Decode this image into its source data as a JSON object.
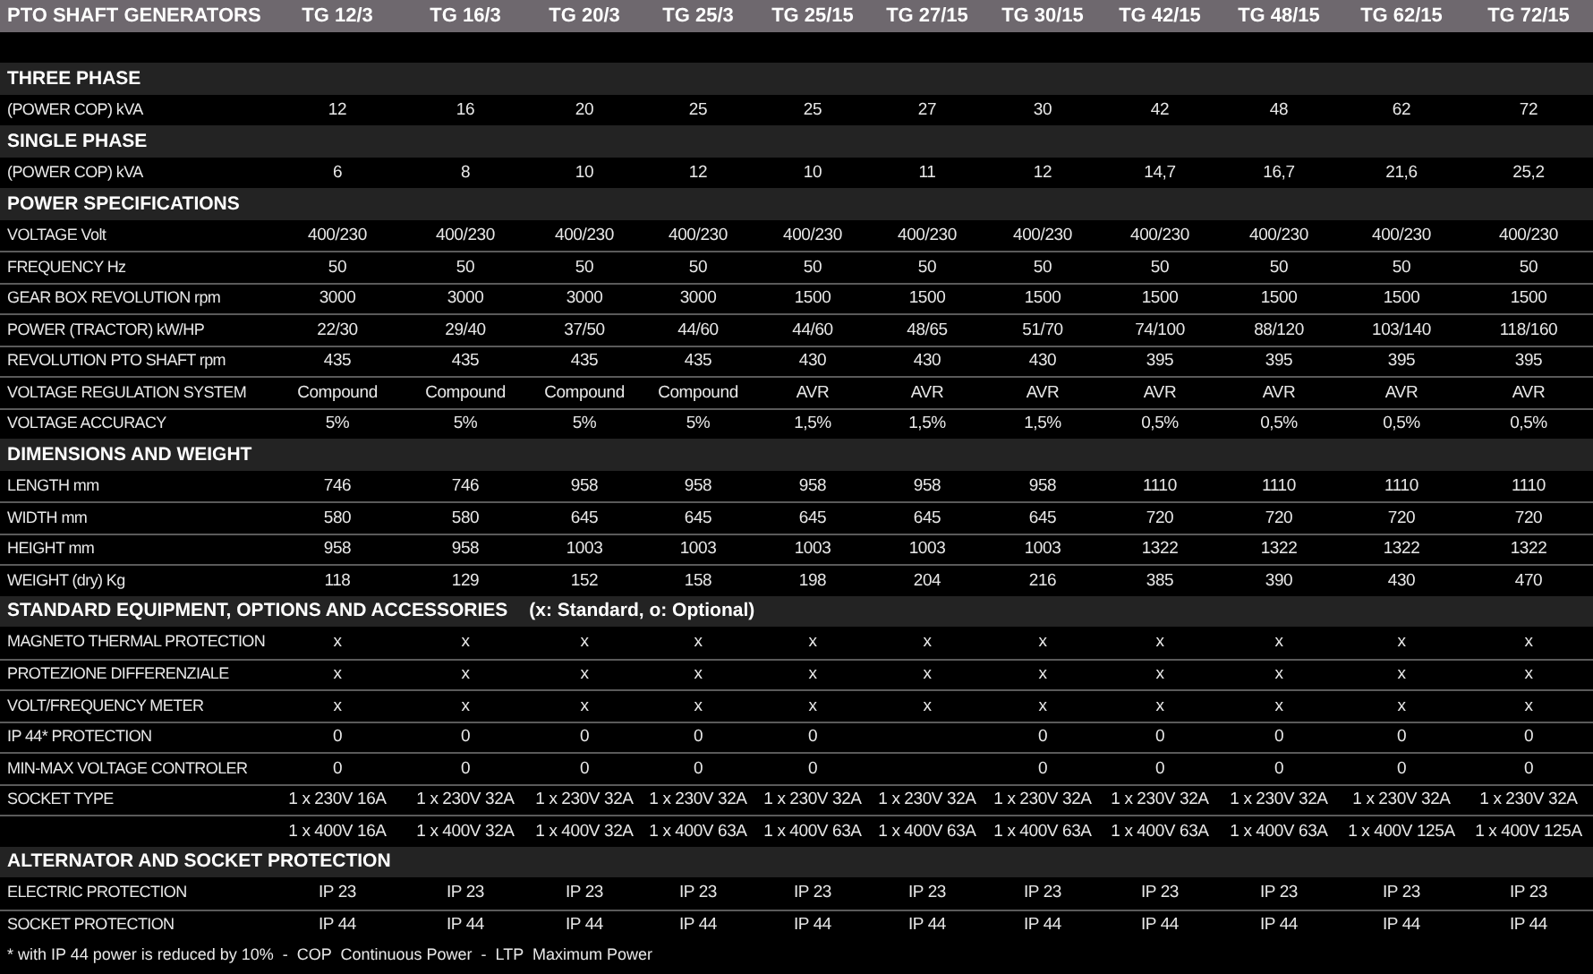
{
  "table": {
    "title": "PTO SHAFT GENERATORS",
    "columns": [
      "TG 12/3",
      "TG 16/3",
      "TG 20/3",
      "TG 25/3",
      "TG 25/15",
      "TG 27/15",
      "TG 30/15",
      "TG 42/15",
      "TG 48/15",
      "TG 62/15",
      "TG 72/15"
    ],
    "sections": [
      {
        "title": "THREE PHASE",
        "rows": [
          {
            "label": "(POWER COP) kVA",
            "values": [
              "12",
              "16",
              "20",
              "25",
              "25",
              "27",
              "30",
              "42",
              "48",
              "62",
              "72"
            ]
          }
        ]
      },
      {
        "title": "SINGLE PHASE",
        "rows": [
          {
            "label": "(POWER COP) kVA",
            "values": [
              "6",
              "8",
              "10",
              "12",
              "10",
              "11",
              "12",
              "14,7",
              "16,7",
              "21,6",
              "25,2"
            ]
          }
        ]
      },
      {
        "title": "POWER SPECIFICATIONS",
        "rows": [
          {
            "label": "VOLTAGE Volt",
            "values": [
              "400/230",
              "400/230",
              "400/230",
              "400/230",
              "400/230",
              "400/230",
              "400/230",
              "400/230",
              "400/230",
              "400/230",
              "400/230"
            ]
          },
          {
            "label": "FREQUENCY Hz",
            "values": [
              "50",
              "50",
              "50",
              "50",
              "50",
              "50",
              "50",
              "50",
              "50",
              "50",
              "50"
            ]
          },
          {
            "label": "GEAR BOX REVOLUTION rpm",
            "values": [
              "3000",
              "3000",
              "3000",
              "3000",
              "1500",
              "1500",
              "1500",
              "1500",
              "1500",
              "1500",
              "1500"
            ]
          },
          {
            "label": "POWER (TRACTOR) kW/HP",
            "values": [
              "22/30",
              "29/40",
              "37/50",
              "44/60",
              "44/60",
              "48/65",
              "51/70",
              "74/100",
              "88/120",
              "103/140",
              "118/160"
            ]
          },
          {
            "label": "REVOLUTION PTO SHAFT rpm",
            "values": [
              "435",
              "435",
              "435",
              "435",
              "430",
              "430",
              "430",
              "395",
              "395",
              "395",
              "395"
            ]
          },
          {
            "label": "VOLTAGE REGULATION SYSTEM",
            "values": [
              "Compound",
              "Compound",
              "Compound",
              "Compound",
              "AVR",
              "AVR",
              "AVR",
              "AVR",
              "AVR",
              "AVR",
              "AVR"
            ]
          },
          {
            "label": "VOLTAGE ACCURACY",
            "values": [
              "5%",
              "5%",
              "5%",
              "5%",
              "1,5%",
              "1,5%",
              "1,5%",
              "0,5%",
              "0,5%",
              "0,5%",
              "0,5%"
            ]
          }
        ]
      },
      {
        "title": "DIMENSIONS AND WEIGHT",
        "rows": [
          {
            "label": "LENGTH mm",
            "values": [
              "746",
              "746",
              "958",
              "958",
              "958",
              "958",
              "958",
              "1110",
              "1110",
              "1110",
              "1110"
            ]
          },
          {
            "label": "WIDTH mm",
            "values": [
              "580",
              "580",
              "645",
              "645",
              "645",
              "645",
              "645",
              "720",
              "720",
              "720",
              "720"
            ]
          },
          {
            "label": "HEIGHT mm",
            "values": [
              "958",
              "958",
              "1003",
              "1003",
              "1003",
              "1003",
              "1003",
              "1322",
              "1322",
              "1322",
              "1322"
            ]
          },
          {
            "label": "WEIGHT (dry) Kg",
            "values": [
              "118",
              "129",
              "152",
              "158",
              "198",
              "204",
              "216",
              "385",
              "390",
              "430",
              "470"
            ]
          }
        ]
      },
      {
        "title": "STANDARD EQUIPMENT, OPTIONS AND ACCESSORIES",
        "note": "(x: Standard, o: Optional)",
        "rows": [
          {
            "label": "MAGNETO THERMAL PROTECTION",
            "values": [
              "x",
              "x",
              "x",
              "x",
              "x",
              "x",
              "x",
              "x",
              "x",
              "x",
              "x"
            ]
          },
          {
            "label": "PROTEZIONE DIFFERENZIALE",
            "values": [
              "x",
              "x",
              "x",
              "x",
              "x",
              "x",
              "x",
              "x",
              "x",
              "x",
              "x"
            ]
          },
          {
            "label": "VOLT/FREQUENCY METER",
            "values": [
              "x",
              "x",
              "x",
              "x",
              "x",
              "x",
              "x",
              "x",
              "x",
              "x",
              "x"
            ]
          },
          {
            "label": "IP 44* PROTECTION",
            "values": [
              "0",
              "0",
              "0",
              "0",
              "0",
              {
                "empty": true
              },
              "0",
              "0",
              "0",
              "0",
              "0"
            ]
          },
          {
            "label": "MIN-MAX VOLTAGE CONTROLER",
            "values": [
              "0",
              "0",
              "0",
              "0",
              "0",
              {
                "empty": true
              },
              "0",
              "0",
              "0",
              "0",
              "0"
            ]
          },
          {
            "label": "SOCKET TYPE",
            "values": [
              "1 x 230V 16A",
              "1 x 230V 32A",
              "1 x 230V 32A",
              "1 x 230V 32A",
              "1 x 230V 32A",
              "1 x 230V 32A",
              "1 x 230V 32A",
              "1 x 230V 32A",
              "1 x 230V 32A",
              "1 x 230V 32A",
              "1 x 230V 32A"
            ]
          },
          {
            "values": [
              "1 x 400V 16A",
              "1 x 400V 32A",
              "1 x 400V 32A",
              "1 x 400V 63A",
              "1 x 400V 63A",
              "1 x 400V 63A",
              "1 x 400V 63A",
              "1 x 400V 63A",
              "1 x 400V 63A",
              "1 x 400V 125A",
              "1 x 400V 125A"
            ]
          }
        ]
      },
      {
        "title": "ALTERNATOR AND SOCKET PROTECTION",
        "rows": [
          {
            "label": "ELECTRIC PROTECTION",
            "values": [
              "IP 23",
              "IP 23",
              "IP 23",
              "IP 23",
              "IP 23",
              "IP 23",
              "IP 23",
              "IP 23",
              "IP 23",
              "IP 23",
              "IP 23"
            ]
          },
          {
            "label": "SOCKET PROTECTION",
            "values": [
              "IP 44",
              "IP 44",
              "IP 44",
              "IP 44",
              "IP 44",
              "IP 44",
              "IP 44",
              "IP 44",
              "IP 44",
              "IP 44",
              "IP 44"
            ]
          }
        ]
      }
    ],
    "footnote": "* with IP 44 power is reduced by 10%  -  COP  Continuous Power  -  LTP  Maximum Power"
  }
}
